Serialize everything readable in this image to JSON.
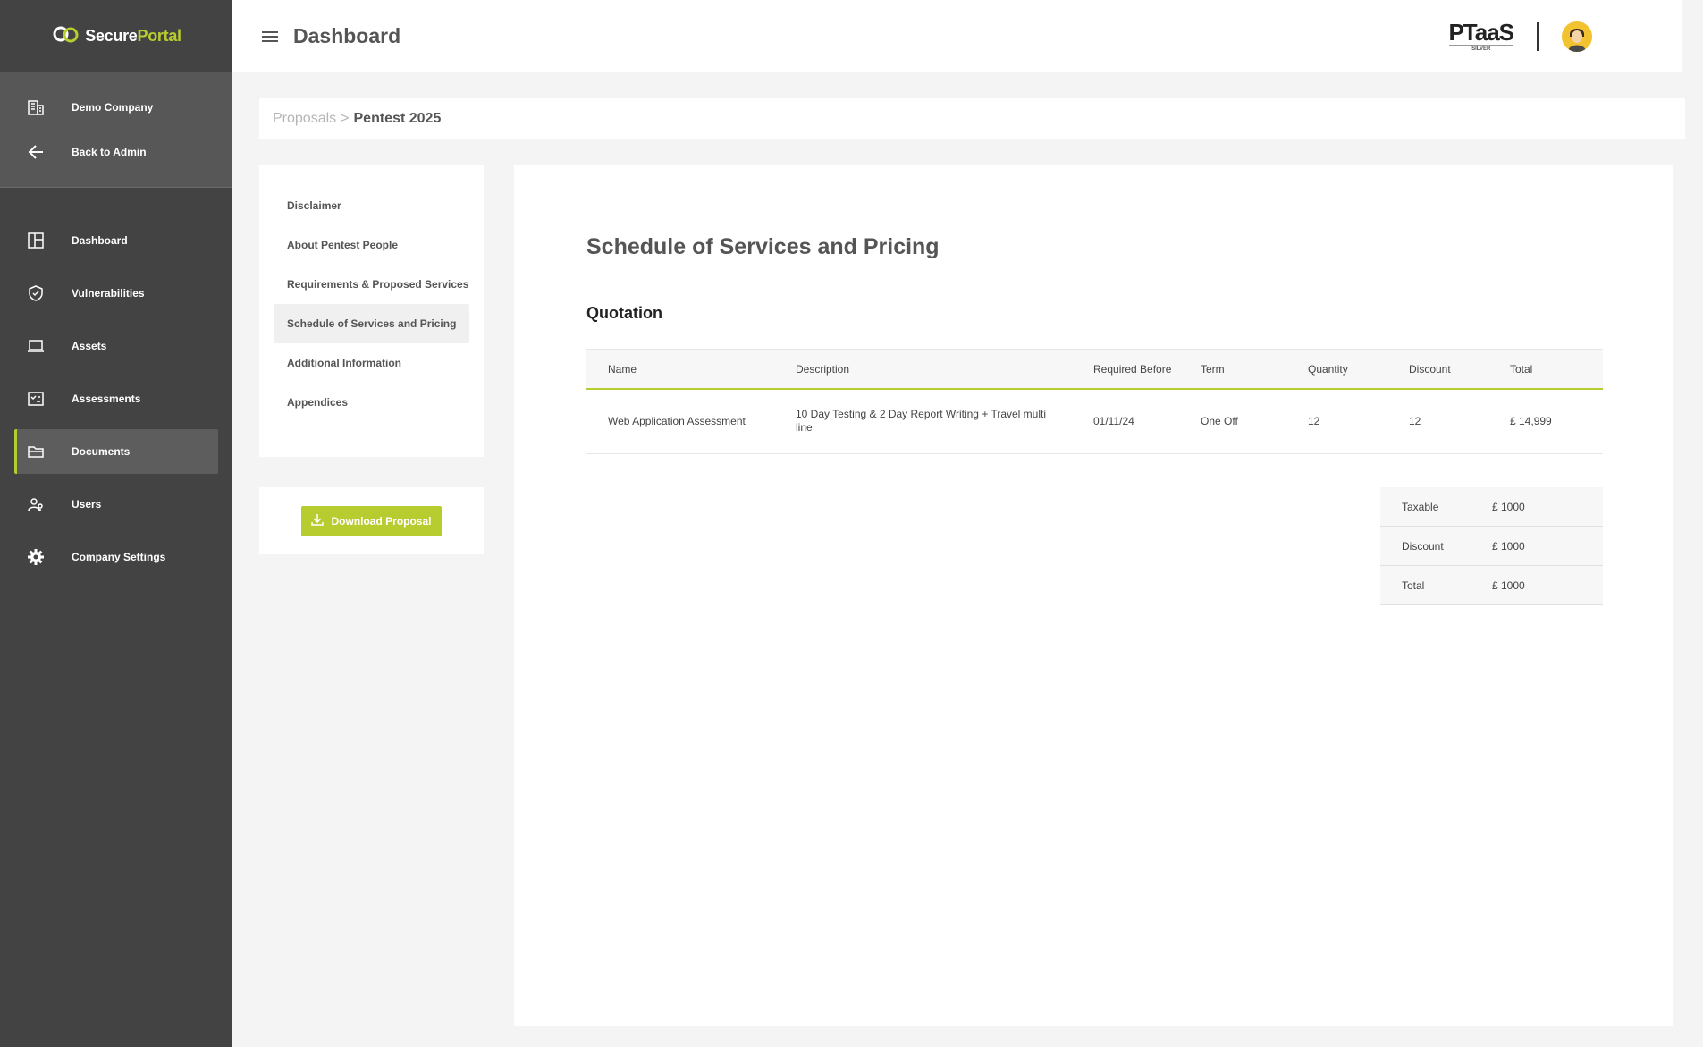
{
  "brand": {
    "logo_part1": "Secure",
    "logo_part2": "Portal",
    "accent_color": "#b7cc2e"
  },
  "sidebar": {
    "company": [
      {
        "label": "Demo Company",
        "icon": "building-icon"
      },
      {
        "label": "Back to Admin",
        "icon": "arrow-left-icon"
      }
    ],
    "items": [
      {
        "label": "Dashboard",
        "icon": "dashboard-icon"
      },
      {
        "label": "Vulnerabilities",
        "icon": "shield-icon"
      },
      {
        "label": "Assets",
        "icon": "laptop-icon"
      },
      {
        "label": "Assessments",
        "icon": "checklist-icon"
      },
      {
        "label": "Documents",
        "icon": "folder-icon",
        "active": true
      },
      {
        "label": "Users",
        "icon": "users-icon"
      },
      {
        "label": "Company Settings",
        "icon": "gear-icon"
      }
    ]
  },
  "header": {
    "title": "Dashboard",
    "badge_main": "PTaaS",
    "badge_sub": "SILVER"
  },
  "breadcrumb": {
    "parent": "Proposals",
    "separator": ">",
    "current": "Pentest 2025"
  },
  "section_nav": {
    "items": [
      "Disclaimer",
      "About Pentest People",
      "Requirements & Proposed Services",
      "Schedule of Services and Pricing",
      "Additional Information",
      "Appendices"
    ],
    "active_index": 3,
    "download_label": "Download Proposal"
  },
  "content": {
    "title": "Schedule of Services and Pricing",
    "quotation_title": "Quotation",
    "columns": [
      "Name",
      "Description",
      "Required Before",
      "Term",
      "Quantity",
      "Discount",
      "Total"
    ],
    "rows": [
      {
        "name": "Web Application Assessment",
        "description": "10 Day Testing & 2 Day Report Writing + Travel multi line",
        "required_before": "01/11/24",
        "term": "One Off",
        "quantity": "12",
        "discount": "12",
        "total": "£ 14,999"
      }
    ],
    "totals": [
      {
        "label": "Taxable",
        "value": "£ 1000"
      },
      {
        "label": "Discount",
        "value": "£ 1000"
      },
      {
        "label": "Total",
        "value": "£ 1000"
      }
    ]
  }
}
